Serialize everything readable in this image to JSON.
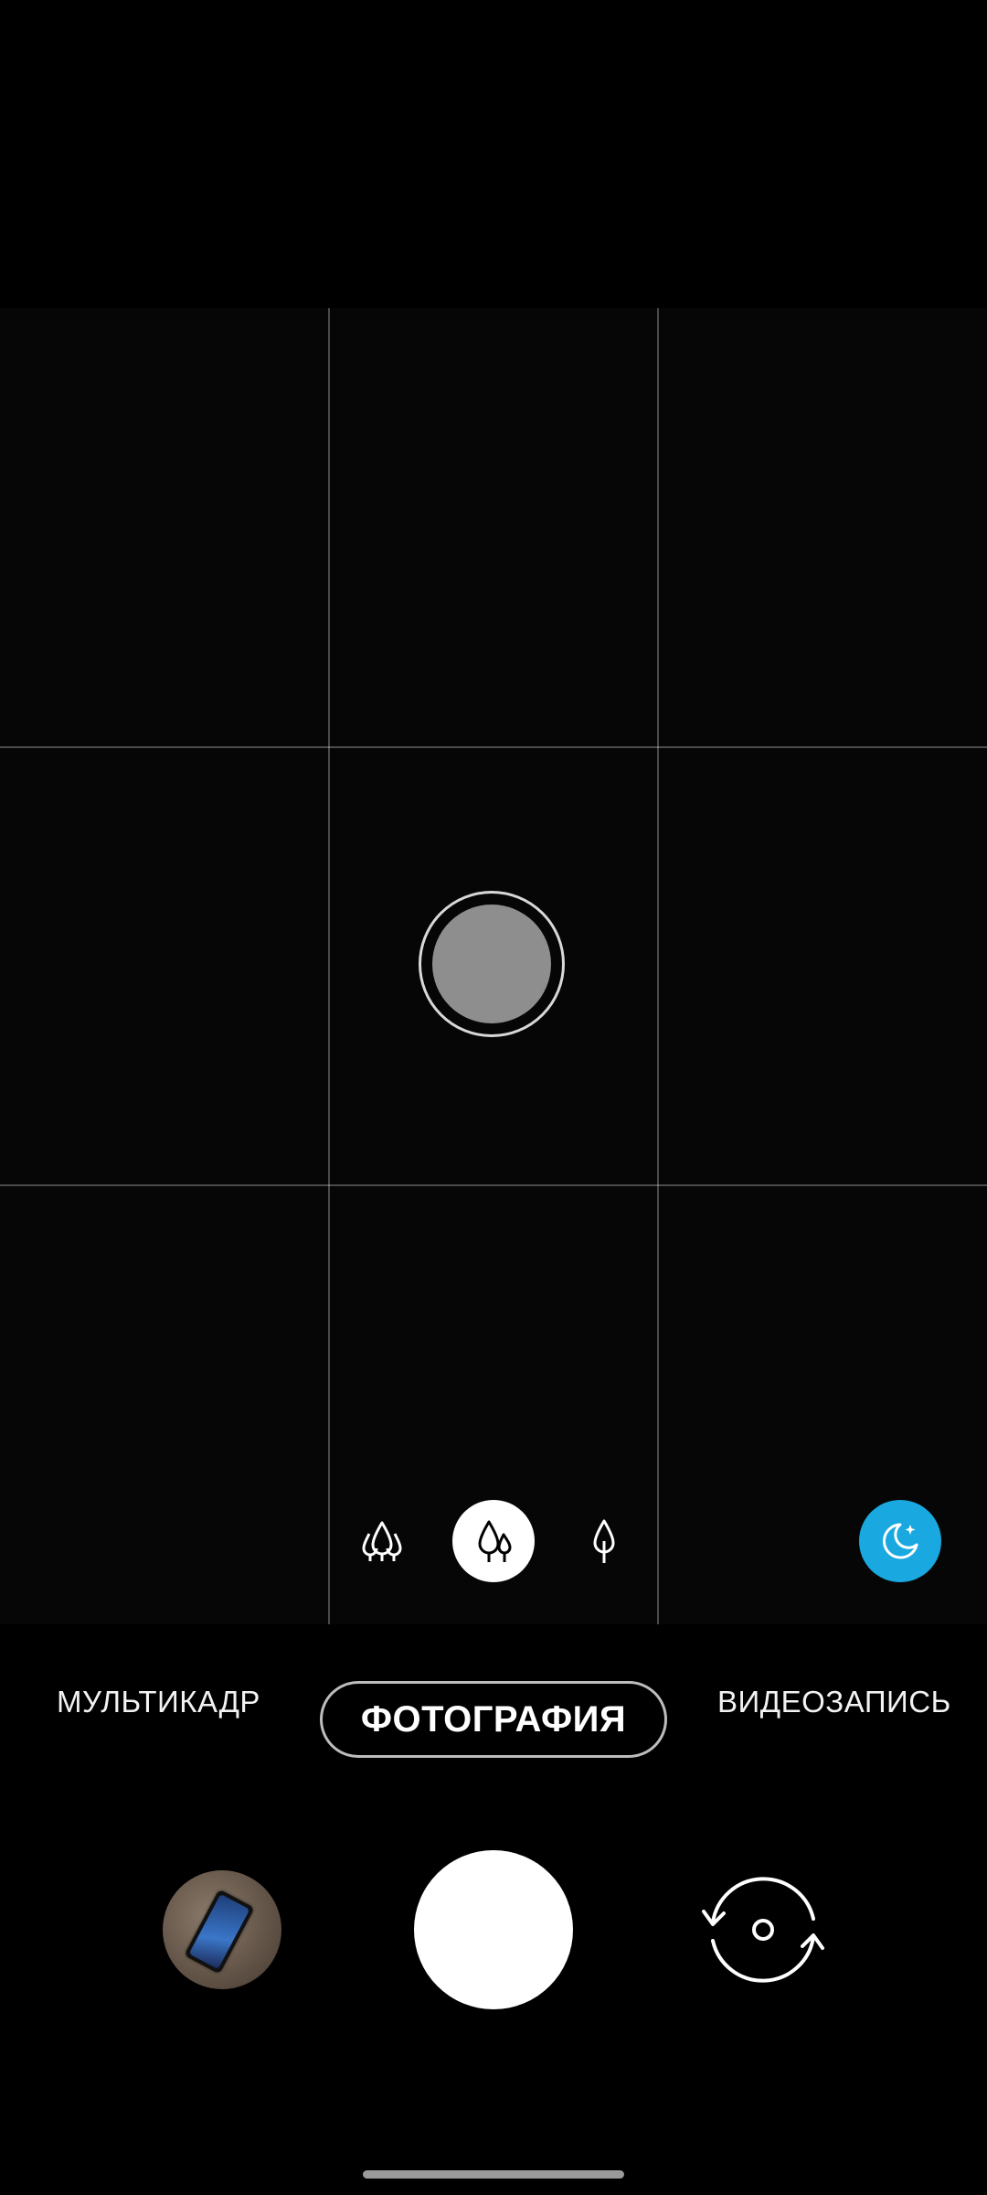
{
  "camera": {
    "modes": {
      "left": "МУЛЬТИКАДР",
      "active": "ФОТОГРАФИЯ",
      "right": "ВИДЕОЗАПИСЬ"
    },
    "zoom_options": [
      {
        "icon": "wide-angle-trees-icon",
        "selected": false
      },
      {
        "icon": "standard-trees-icon",
        "selected": true
      },
      {
        "icon": "telephoto-tree-icon",
        "selected": false
      }
    ],
    "night_mode": {
      "icon": "moon-stars-icon",
      "color": "#1aa8e0",
      "active": true
    },
    "grid": {
      "columns": 3,
      "rows": 3,
      "enabled": true
    },
    "gallery_thumbnail": {
      "icon": "gallery-thumbnail"
    },
    "shutter": {
      "icon": "shutter-button"
    },
    "switch_camera": {
      "icon": "switch-camera-icon"
    }
  }
}
